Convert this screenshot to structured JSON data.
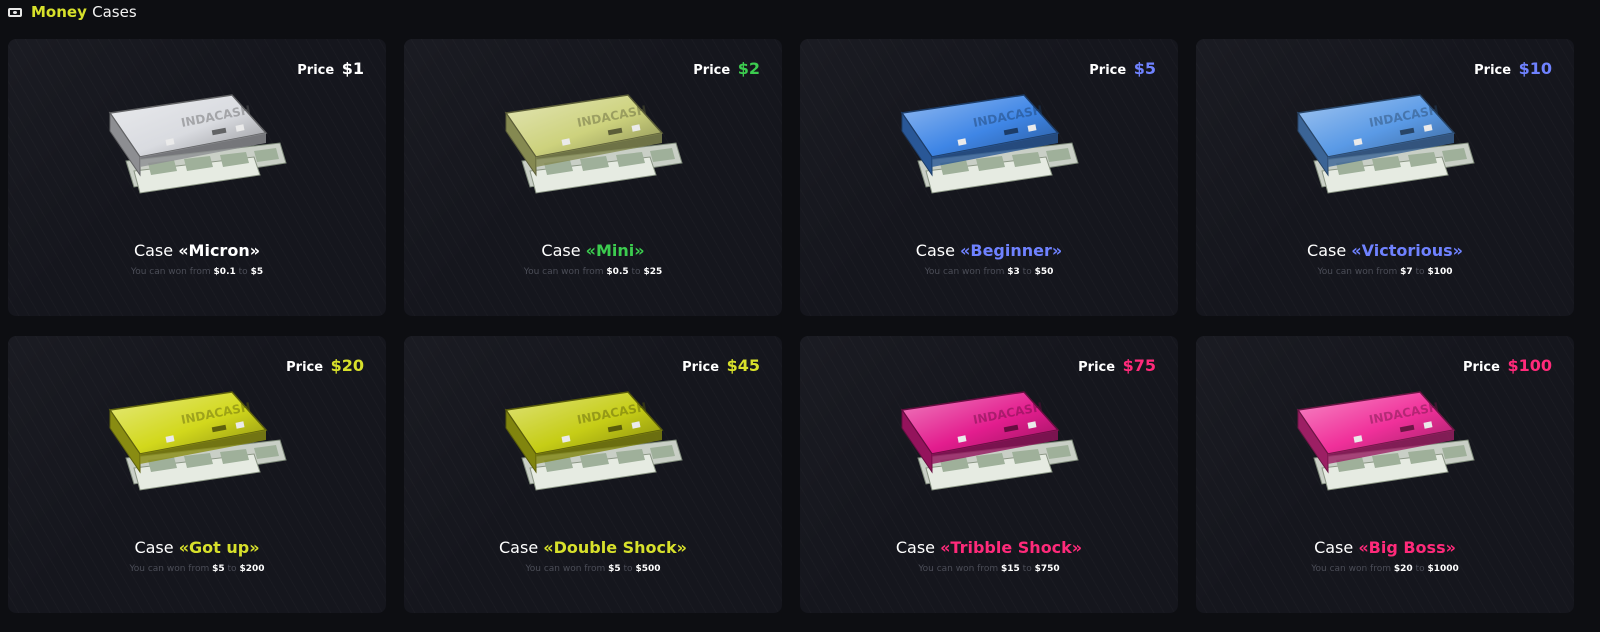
{
  "section": {
    "title_accent": "Money",
    "title_rest": "Cases",
    "icon": "banknote-icon",
    "accent_color": "#d7e02b"
  },
  "labels": {
    "price": "Price",
    "case": "Case",
    "win_prefix": "You can won from",
    "win_mid": "to",
    "brand": "INDACASH"
  },
  "cases": [
    {
      "price": "$1",
      "name": "«Micron»",
      "min": "$0.1",
      "max": "$5",
      "accent": "#ffffff",
      "case_color": "#d9dbe0"
    },
    {
      "price": "$2",
      "name": "«Mini»",
      "min": "$0.5",
      "max": "$25",
      "accent": "#3ccc4f",
      "case_color": "#cdd27d"
    },
    {
      "price": "$5",
      "name": "«Beginner»",
      "min": "$3",
      "max": "$50",
      "accent": "#6f82ff",
      "case_color": "#3f86e6"
    },
    {
      "price": "$10",
      "name": "«Victorious»",
      "min": "$7",
      "max": "$100",
      "accent": "#6f82ff",
      "case_color": "#5a9ae6"
    },
    {
      "price": "$20",
      "name": "«Got up»",
      "min": "$5",
      "max": "$200",
      "accent": "#d7e02b",
      "case_color": "#d2d81c"
    },
    {
      "price": "$45",
      "name": "«Double Shock»",
      "min": "$5",
      "max": "$500",
      "accent": "#d7e02b",
      "case_color": "#c6cd16"
    },
    {
      "price": "$75",
      "name": "«Tribble Shock»",
      "min": "$15",
      "max": "$750",
      "accent": "#ff2a7a",
      "case_color": "#e31d8e"
    },
    {
      "price": "$100",
      "name": "«Big Boss»",
      "min": "$20",
      "max": "$1000",
      "accent": "#ff2a7a",
      "case_color": "#f0309a"
    }
  ]
}
